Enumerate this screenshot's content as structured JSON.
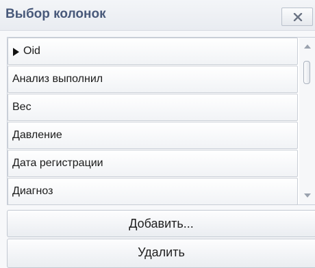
{
  "dialog": {
    "title": "Выбор колонок",
    "close_icon": "close-icon"
  },
  "columns": [
    {
      "label": "Oid",
      "current": true
    },
    {
      "label": "Анализ выполнил"
    },
    {
      "label": "Вес"
    },
    {
      "label": "Давление"
    },
    {
      "label": "Дата регистрации"
    },
    {
      "label": "Диагноз"
    }
  ],
  "buttons": {
    "add_label": "Добавить...",
    "remove_label": "Удалить"
  },
  "colors": {
    "title_text": "#48597a",
    "row_border": "#c9ced6",
    "background": "#f7f8fa"
  }
}
